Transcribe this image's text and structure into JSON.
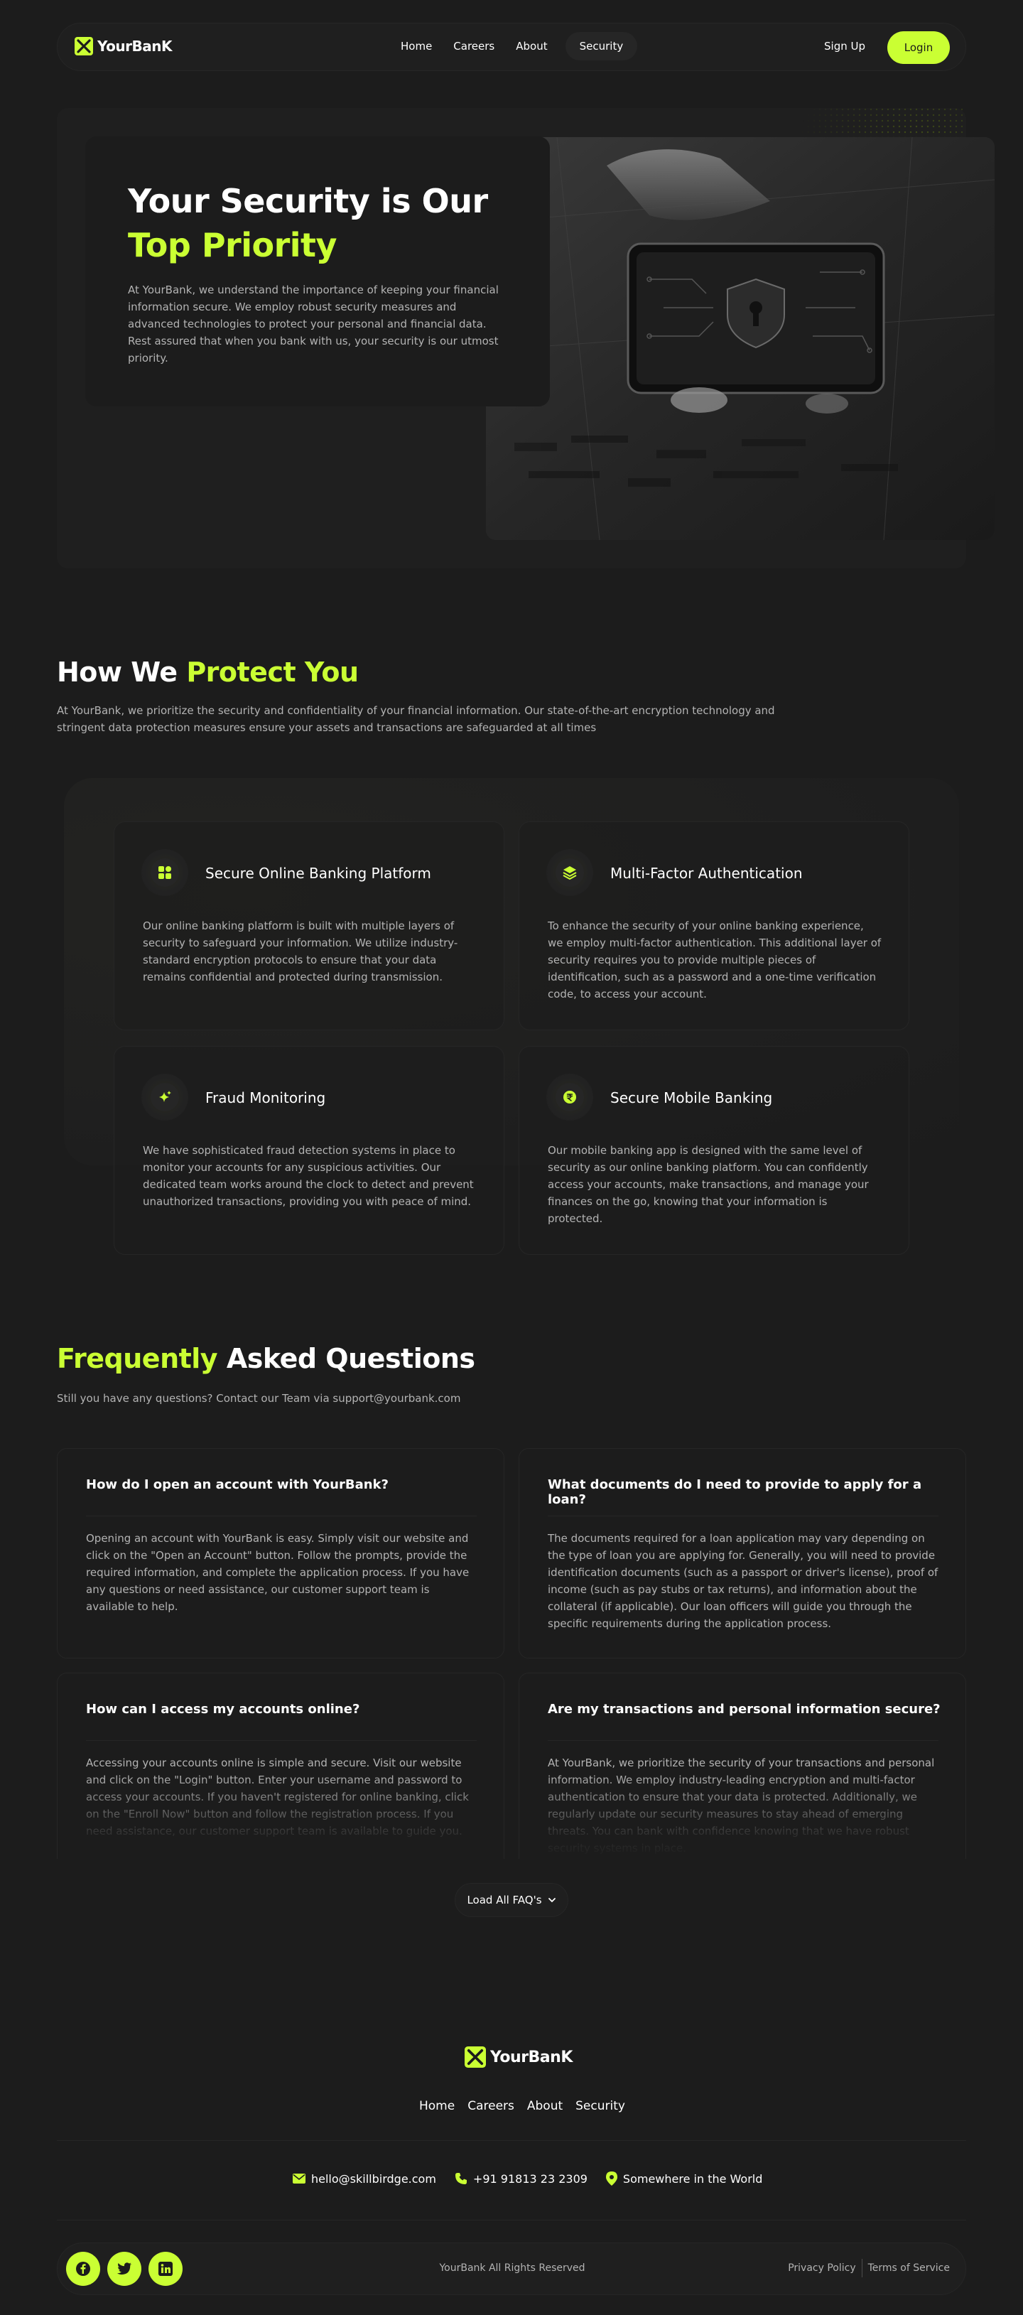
{
  "colors": {
    "background": "#1c1c1c",
    "accent": "#caff33",
    "text_muted": "#b3b3b3",
    "border": "#262626"
  },
  "nav": {
    "logo": "YourBanK",
    "links": [
      "Home",
      "Careers",
      "About",
      "Security"
    ],
    "active": "Security",
    "signup": "Sign Up",
    "login": "Login"
  },
  "hero": {
    "title_1": "Your Security is Our",
    "title_2": "Top Priority",
    "description": "At YourBank, we understand the importance of keeping your financial information secure. We employ robust security measures and advanced technologies to protect your personal and financial data. Rest assured that when you bank with us, your security is our utmost priority."
  },
  "protect": {
    "title_1": "How We",
    "title_2": "Protect You",
    "description": "At YourBank, we prioritize the security and confidentiality of your financial information. Our state-of-the-art encryption technology and stringent data protection measures ensure your assets and transactions are safeguarded at all times",
    "features": [
      {
        "icon": "grid-icon",
        "title": "Secure Online Banking Platform",
        "description": "Our online banking platform is built with multiple layers of security to safeguard your information. We utilize industry-standard encryption protocols to ensure that your data remains confidential and protected during transmission."
      },
      {
        "icon": "layers-icon",
        "title": "Multi-Factor Authentication",
        "description": "To enhance the security of your online banking experience, we employ multi-factor authentication. This additional layer of security requires you to provide multiple pieces of identification, such as a password and a one-time verification code, to access your account."
      },
      {
        "icon": "sparkle-icon",
        "title": "Fraud Monitoring",
        "description": "We have sophisticated fraud detection systems in place to monitor your accounts for any suspicious activities. Our dedicated team works around the clock to detect and prevent unauthorized transactions, providing you with peace of mind."
      },
      {
        "icon": "rupee-icon",
        "title": "Secure Mobile Banking",
        "description": "Our mobile banking app is designed with the same level of security as our online banking platform. You can confidently access your accounts, make transactions, and manage your finances on the go, knowing that your information is protected."
      }
    ]
  },
  "faq": {
    "title_1": "Frequently",
    "title_2": "Asked Questions",
    "subtitle": "Still you have any questions? Contact our Team via support@yourbank.com",
    "items": [
      {
        "q": "How do I open an account with YourBank?",
        "a": "Opening an account with YourBank is easy. Simply visit our website and click on the \"Open an Account\" button. Follow the prompts, provide the required information, and complete the application process. If you have any questions or need assistance, our customer support team is available to help."
      },
      {
        "q": "What documents do I need to provide to apply for a loan?",
        "a": "The documents required for a loan application may vary depending on the type of loan you are applying for. Generally, you will need to provide identification documents (such as a passport or driver's license), proof of income (such as pay stubs or tax returns), and information about the collateral (if applicable). Our loan officers will guide you through the specific requirements during the application process."
      },
      {
        "q": "How can I access my accounts online?",
        "a": "Accessing your accounts online is simple and secure. Visit our website and click on the \"Login\" button. Enter your username and password to access your accounts. If you haven't registered for online banking, click on the \"Enroll Now\" button and follow the registration process. If you need assistance, our customer support team is available to guide you."
      },
      {
        "q": "Are my transactions and personal information secure?",
        "a": "At YourBank, we prioritize the security of your transactions and personal information. We employ industry-leading encryption and multi-factor authentication to ensure that your data is protected. Additionally, we regularly update our security measures to stay ahead of emerging threats. You can bank with confidence knowing that we have robust security systems in place."
      }
    ],
    "load_more": "Load All FAQ's"
  },
  "footer": {
    "logo": "YourBanK",
    "links": [
      "Home",
      "Careers",
      "About",
      "Security"
    ],
    "email": "hello@skillbirdge.com",
    "phone": "+91 91813 23 2309",
    "location": "Somewhere in the World",
    "social": [
      "facebook-icon",
      "twitter-icon",
      "linkedin-icon"
    ],
    "copyright": "YourBank All Rights Reserved",
    "privacy": "Privacy Policy",
    "terms": "Terms of Service"
  }
}
